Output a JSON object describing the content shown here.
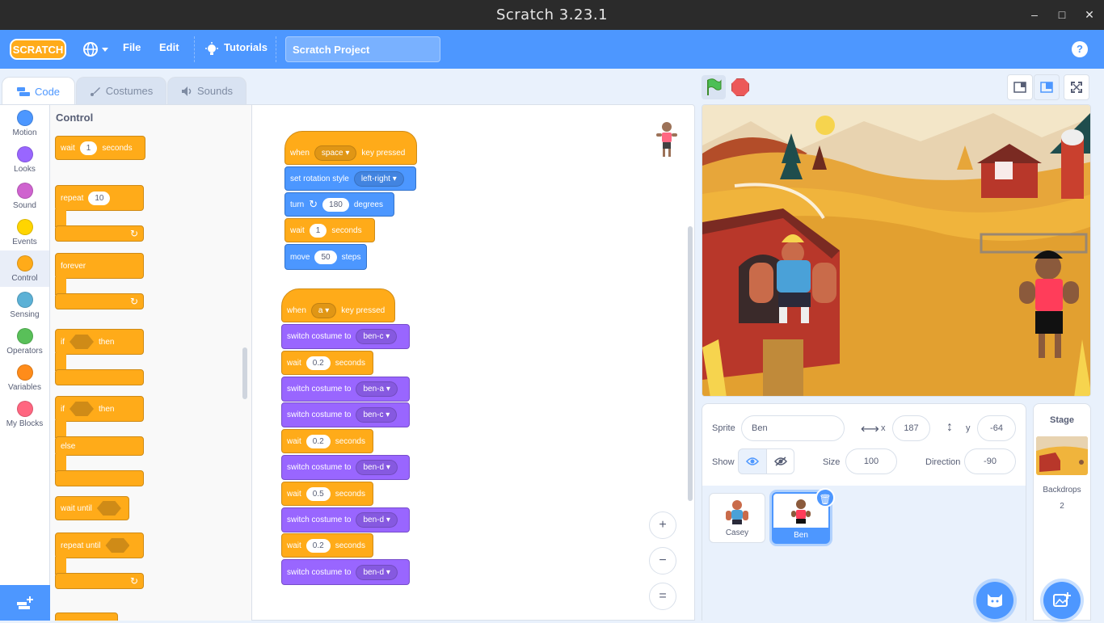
{
  "window": {
    "title": "Scratch 3.23.1",
    "min": "–",
    "max": "□",
    "close": "✕"
  },
  "menu": {
    "logo": "SCRATCH",
    "file": "File",
    "edit": "Edit",
    "tutorials": "Tutorials",
    "project_title": "Scratch Project",
    "help": "?"
  },
  "tabs": {
    "code": "Code",
    "costumes": "Costumes",
    "sounds": "Sounds"
  },
  "categories": [
    {
      "label": "Motion",
      "color": "#4c97ff"
    },
    {
      "label": "Looks",
      "color": "#9966ff"
    },
    {
      "label": "Sound",
      "color": "#cf63cf"
    },
    {
      "label": "Events",
      "color": "#ffd500"
    },
    {
      "label": "Control",
      "color": "#ffab19"
    },
    {
      "label": "Sensing",
      "color": "#5cb1d6"
    },
    {
      "label": "Operators",
      "color": "#59c059"
    },
    {
      "label": "Variables",
      "color": "#ff8c1a"
    },
    {
      "label": "My Blocks",
      "color": "#ff6680"
    }
  ],
  "palette": {
    "title": "Control",
    "wait": {
      "pre": "wait",
      "val": "1",
      "post": "seconds"
    },
    "repeat": {
      "pre": "repeat",
      "val": "10"
    },
    "forever": "forever",
    "if_then": {
      "pre": "if",
      "post": "then"
    },
    "if_else": {
      "pre": "if",
      "post": "then",
      "else": "else"
    },
    "wait_until": "wait until",
    "repeat_until": "repeat until"
  },
  "script1": {
    "when": "when",
    "key": "space",
    "pressed": "key pressed",
    "rotation": {
      "pre": "set rotation style",
      "val": "left-right"
    },
    "turn": {
      "pre": "turn",
      "val": "180",
      "post": "degrees"
    },
    "wait": {
      "pre": "wait",
      "val": "1",
      "post": "seconds"
    },
    "move": {
      "pre": "move",
      "val": "50",
      "post": "steps"
    }
  },
  "script2": {
    "when": "when",
    "key": "a",
    "pressed": "key pressed",
    "rows": [
      {
        "type": "costume",
        "pre": "switch costume to",
        "val": "ben-c"
      },
      {
        "type": "wait",
        "pre": "wait",
        "val": "0.2",
        "post": "seconds"
      },
      {
        "type": "costume",
        "pre": "switch costume to",
        "val": "ben-a"
      },
      {
        "type": "costume",
        "pre": "switch costume to",
        "val": "ben-c"
      },
      {
        "type": "wait",
        "pre": "wait",
        "val": "0.2",
        "post": "seconds"
      },
      {
        "type": "costume",
        "pre": "switch costume to",
        "val": "ben-d"
      },
      {
        "type": "wait",
        "pre": "wait",
        "val": "0.5",
        "post": "seconds"
      },
      {
        "type": "costume",
        "pre": "switch costume to",
        "val": "ben-d"
      },
      {
        "type": "wait",
        "pre": "wait",
        "val": "0.2",
        "post": "seconds"
      },
      {
        "type": "costume",
        "pre": "switch costume to",
        "val": "ben-d"
      }
    ]
  },
  "zoom": {
    "in": "+",
    "out": "−",
    "reset": "="
  },
  "sprite_info": {
    "sprite_label": "Sprite",
    "sprite_name": "Ben",
    "x_label": "x",
    "x": "187",
    "y_label": "y",
    "y": "-64",
    "show_label": "Show",
    "size_label": "Size",
    "size": "100",
    "direction_label": "Direction",
    "direction": "-90"
  },
  "sprites": [
    {
      "name": "Casey"
    },
    {
      "name": "Ben"
    }
  ],
  "stage_pane": {
    "title": "Stage",
    "backdrops_label": "Backdrops",
    "backdrops_count": "2"
  }
}
